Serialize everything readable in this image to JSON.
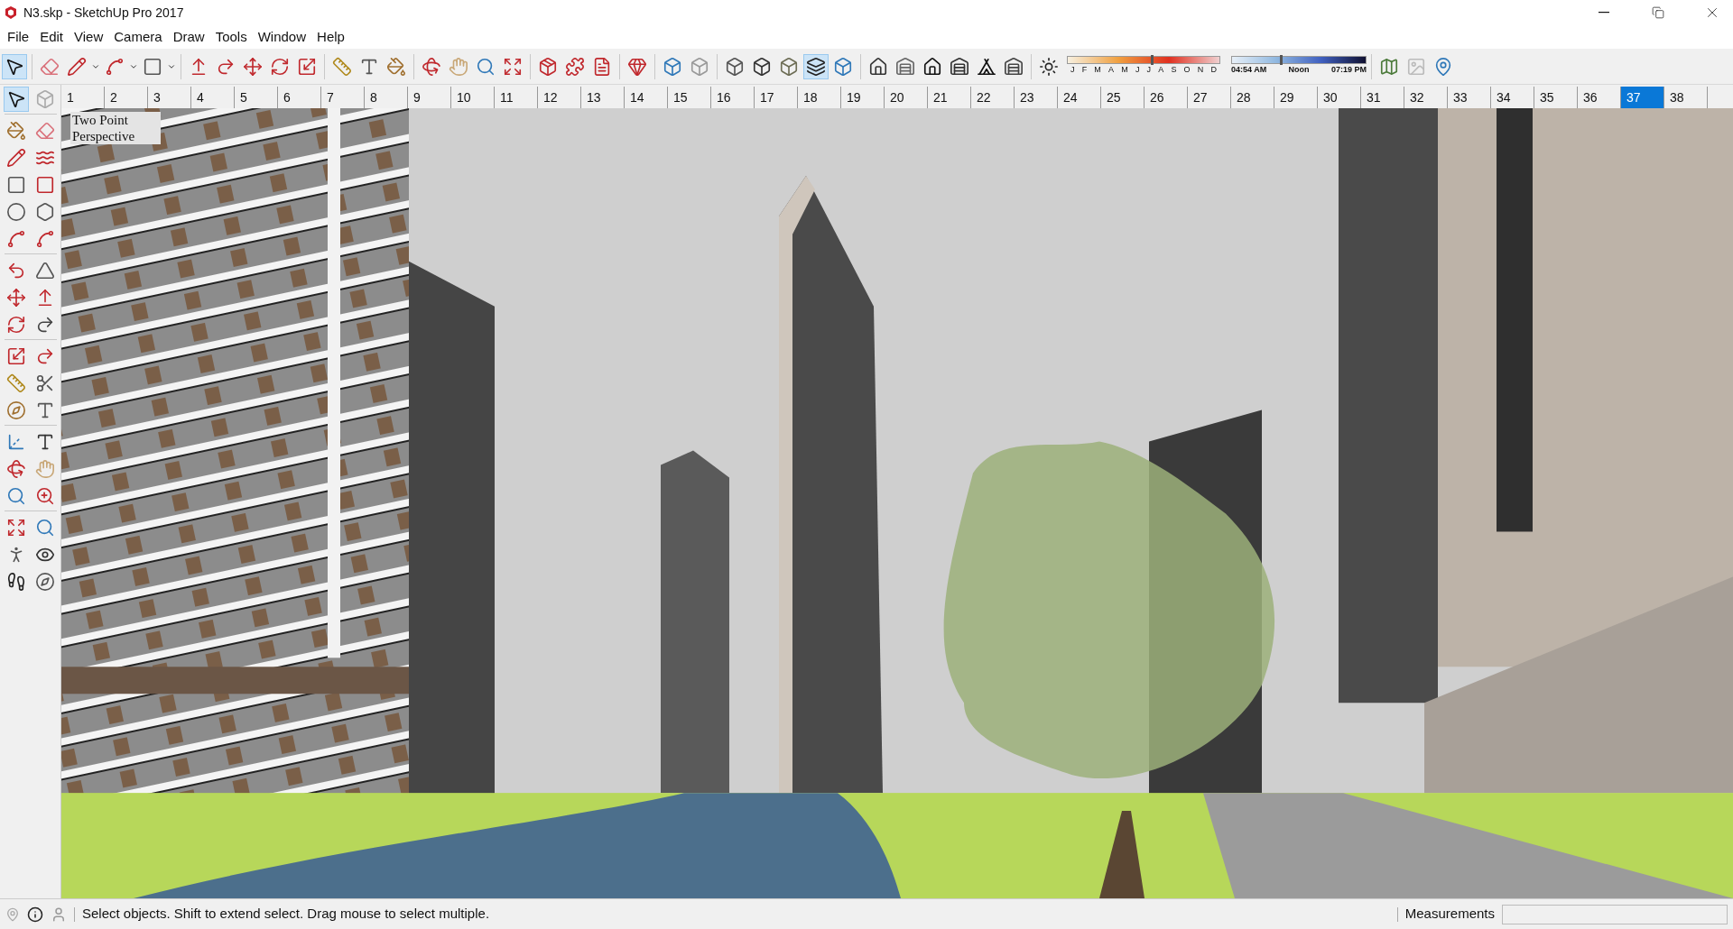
{
  "window": {
    "title": "N3.skp - SketchUp Pro 2017"
  },
  "menu": [
    "File",
    "Edit",
    "View",
    "Camera",
    "Draw",
    "Tools",
    "Window",
    "Help"
  ],
  "toolbar": {
    "select_tool": {
      "selected": true
    },
    "face_styles": [
      {
        "selected": false
      },
      {
        "selected": false
      },
      {
        "selected": false
      },
      {
        "selected": true
      },
      {
        "selected": false
      }
    ]
  },
  "shadow_settings": {
    "months": [
      "J",
      "F",
      "M",
      "A",
      "M",
      "J",
      "J",
      "A",
      "S",
      "O",
      "N",
      "D"
    ],
    "month_slider": {
      "level": 0.55
    },
    "times": [
      "04:54 AM",
      "Noon",
      "07:19 PM"
    ],
    "time_slider": {
      "level": 0.36
    }
  },
  "scene_tabs": [
    {
      "label": "1",
      "selected": false
    },
    {
      "label": "2",
      "selected": false
    },
    {
      "label": "3",
      "selected": false
    },
    {
      "label": "4",
      "selected": false
    },
    {
      "label": "5",
      "selected": false
    },
    {
      "label": "6",
      "selected": false
    },
    {
      "label": "7",
      "selected": false
    },
    {
      "label": "8",
      "selected": false
    },
    {
      "label": "9",
      "selected": false
    },
    {
      "label": "10",
      "selected": false
    },
    {
      "label": "11",
      "selected": false
    },
    {
      "label": "12",
      "selected": false
    },
    {
      "label": "13",
      "selected": false
    },
    {
      "label": "14",
      "selected": false
    },
    {
      "label": "15",
      "selected": false
    },
    {
      "label": "16",
      "selected": false
    },
    {
      "label": "17",
      "selected": false
    },
    {
      "label": "18",
      "selected": false
    },
    {
      "label": "19",
      "selected": false
    },
    {
      "label": "20",
      "selected": false
    },
    {
      "label": "21",
      "selected": false
    },
    {
      "label": "22",
      "selected": false
    },
    {
      "label": "23",
      "selected": false
    },
    {
      "label": "24",
      "selected": false
    },
    {
      "label": "25",
      "selected": false
    },
    {
      "label": "26",
      "selected": false
    },
    {
      "label": "27",
      "selected": false
    },
    {
      "label": "28",
      "selected": false
    },
    {
      "label": "29",
      "selected": false
    },
    {
      "label": "30",
      "selected": false
    },
    {
      "label": "31",
      "selected": false
    },
    {
      "label": "32",
      "selected": false
    },
    {
      "label": "33",
      "selected": false
    },
    {
      "label": "34",
      "selected": false
    },
    {
      "label": "35",
      "selected": false
    },
    {
      "label": "36",
      "selected": false
    },
    {
      "label": "37",
      "selected": true
    },
    {
      "label": "38",
      "selected": false
    }
  ],
  "tool_palette": {
    "select_tool": {
      "selected": true
    }
  },
  "viewport": {
    "camera_label": "Two Point Perspective"
  },
  "status_bar": {
    "hint": "Select objects. Shift to extend select. Drag mouse to select multiple.",
    "measurements_label": "Measurements"
  }
}
